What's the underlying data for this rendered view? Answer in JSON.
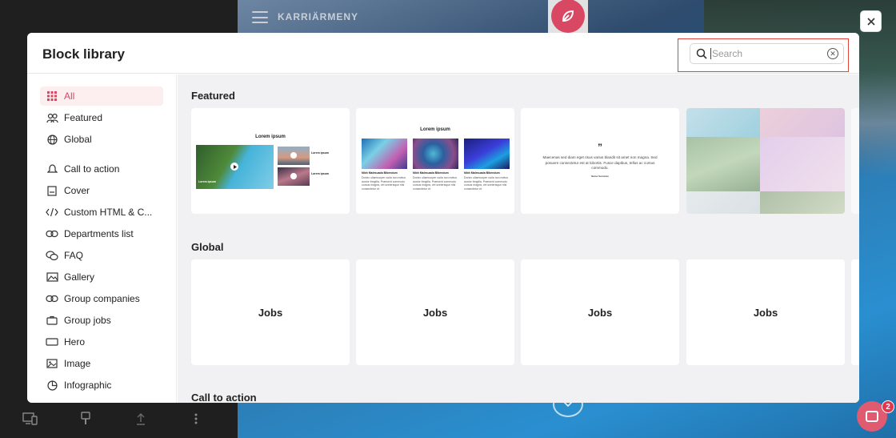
{
  "app": {
    "brand": "KARRIÄRMENY",
    "chat_badge_count": "2"
  },
  "modal": {
    "title": "Block library",
    "search": {
      "placeholder": "Search",
      "value": ""
    }
  },
  "sidebar": {
    "items": [
      {
        "label": "All",
        "icon": "grid-icon",
        "active": true
      },
      {
        "label": "Featured",
        "icon": "featured-people-icon"
      },
      {
        "label": "Global",
        "icon": "globe-icon"
      },
      {
        "label": "Call to action",
        "icon": "bell-icon"
      },
      {
        "label": "Cover",
        "icon": "cover-image-icon"
      },
      {
        "label": "Custom HTML & C...",
        "icon": "code-icon"
      },
      {
        "label": "Departments list",
        "icon": "link-icon"
      },
      {
        "label": "FAQ",
        "icon": "chat-bubbles-icon"
      },
      {
        "label": "Gallery",
        "icon": "gallery-icon"
      },
      {
        "label": "Group companies",
        "icon": "link-icon"
      },
      {
        "label": "Group jobs",
        "icon": "briefcase-icon"
      },
      {
        "label": "Hero",
        "icon": "hero-rectangle-icon"
      },
      {
        "label": "Image",
        "icon": "image-icon"
      },
      {
        "label": "Infographic",
        "icon": "pie-chart-icon"
      }
    ]
  },
  "sections": {
    "featured": {
      "title": "Featured",
      "cards": {
        "video": {
          "heading": "Lorem ipsum",
          "main_caption": "Lorem ipsum",
          "side_title_1": "Lorem ipsum",
          "side_title_2": "Lorem ipsum"
        },
        "columns": {
          "heading": "Lorem ipsum",
          "col_title": "Nibh Malesuada Bibendum",
          "col_text": "Donec ullamcorper nulla non metus auctor fringilla. Praesent commodo cursus magna, vel scelerisque nisl consectetur et."
        },
        "quote": {
          "quote_mark": "”",
          "text": "Maecenas sed diam eget risus varius blandit sit amet non magna. Sed posuere consectetur est at lobortis. Fusce dapibus, tellus ac cursus commodo.",
          "author": "Name Surname"
        }
      }
    },
    "global": {
      "title": "Global",
      "cards": [
        "Jobs",
        "Jobs",
        "Jobs",
        "Jobs"
      ]
    },
    "call_to_action": {
      "title": "Call to action"
    }
  },
  "colors": {
    "accent": "#d94863",
    "highlight_border": "#e0443a",
    "content_bg": "#f1f1f3"
  }
}
